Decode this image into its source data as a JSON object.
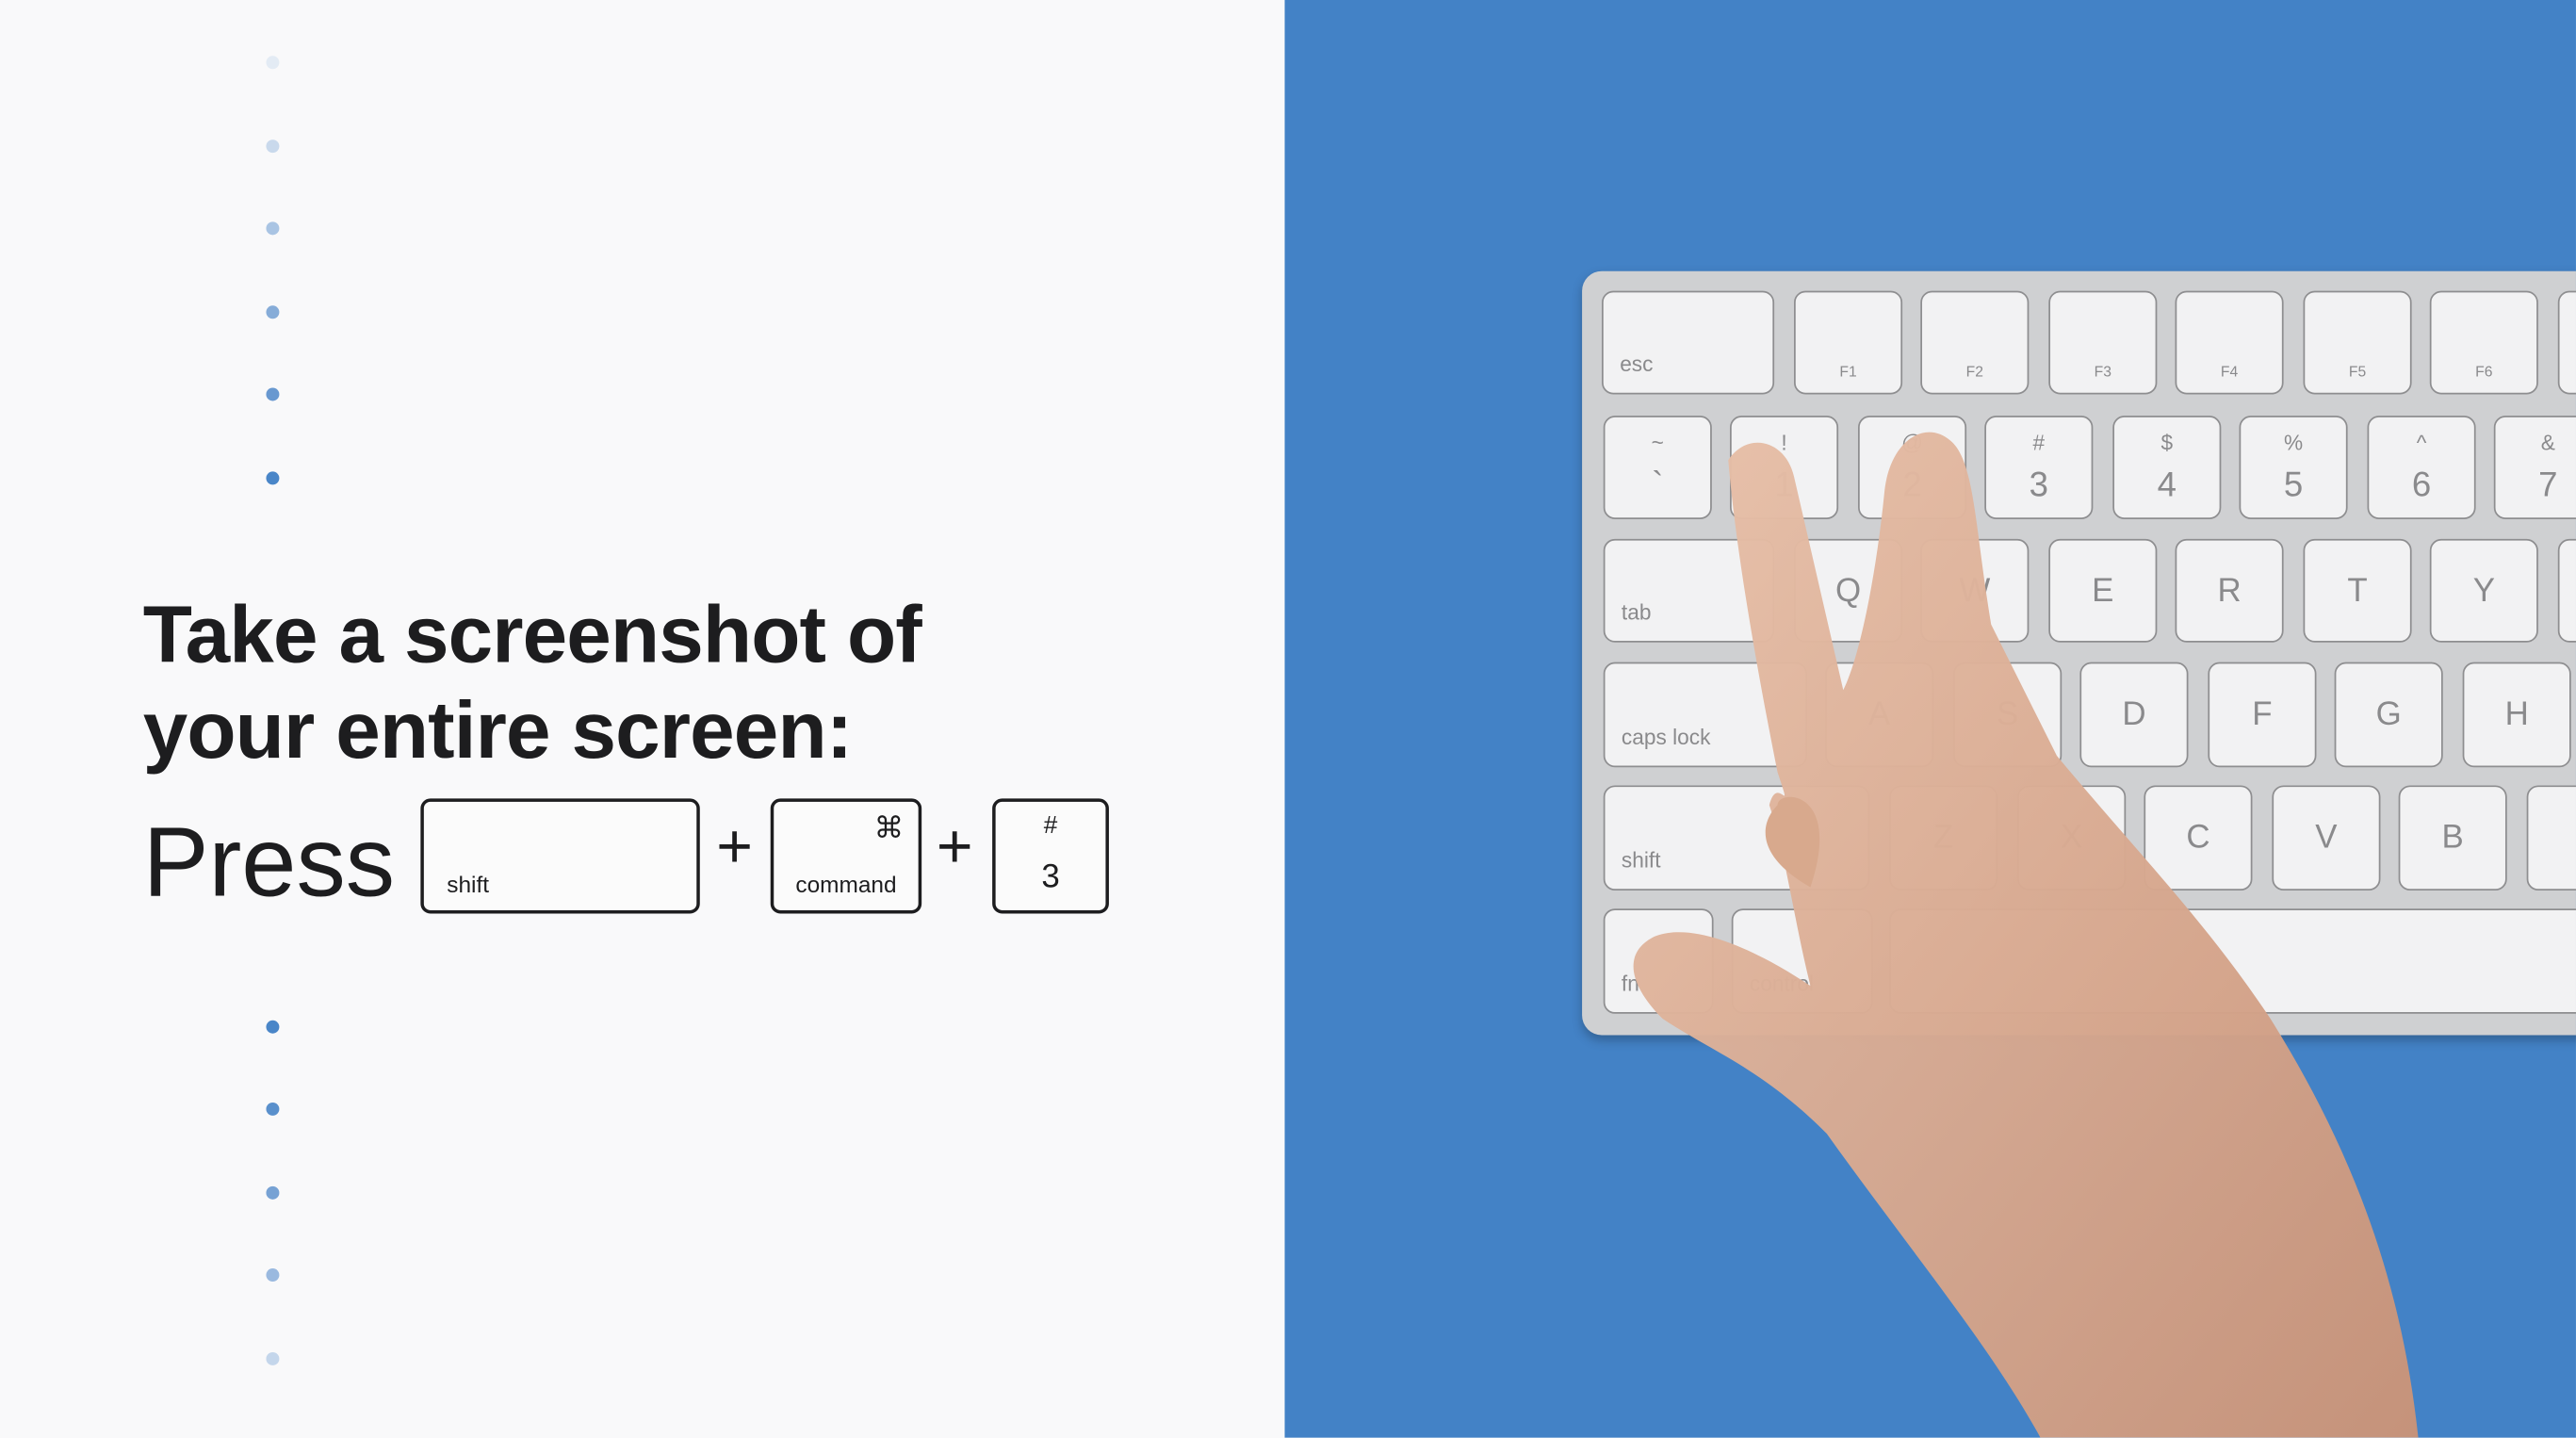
{
  "heading": {
    "line1": "Take a screenshot of",
    "line2": "your entire screen:"
  },
  "instruction": {
    "press": "Press",
    "plus": "+",
    "keys": [
      {
        "label": "shift",
        "symbol": ""
      },
      {
        "label": "command",
        "symbol": "⌘"
      },
      {
        "label": "3",
        "symbol": "#"
      }
    ]
  },
  "colors": {
    "accent_blue": "#4382c6",
    "dot": "#4a86c8",
    "text": "#1d1d1f"
  },
  "keyboard": {
    "row0": [
      "esc",
      "F1",
      "F2",
      "F3",
      "F4",
      "F5",
      "F6"
    ],
    "row1": [
      [
        "~",
        "`"
      ],
      [
        "!",
        "1"
      ],
      [
        "@",
        "2"
      ],
      [
        "#",
        "3"
      ],
      [
        "$",
        "4"
      ],
      [
        "%",
        "5"
      ],
      [
        "^",
        "6"
      ],
      [
        "&",
        "7"
      ]
    ],
    "row2": [
      "tab",
      "Q",
      "W",
      "E",
      "R",
      "T",
      "Y"
    ],
    "row3": [
      "caps lock",
      "A",
      "S",
      "D",
      "F",
      "G",
      "H"
    ],
    "row4": [
      "shift",
      "Z",
      "X",
      "C",
      "V",
      "B"
    ],
    "row5": [
      "fn",
      "control"
    ]
  }
}
